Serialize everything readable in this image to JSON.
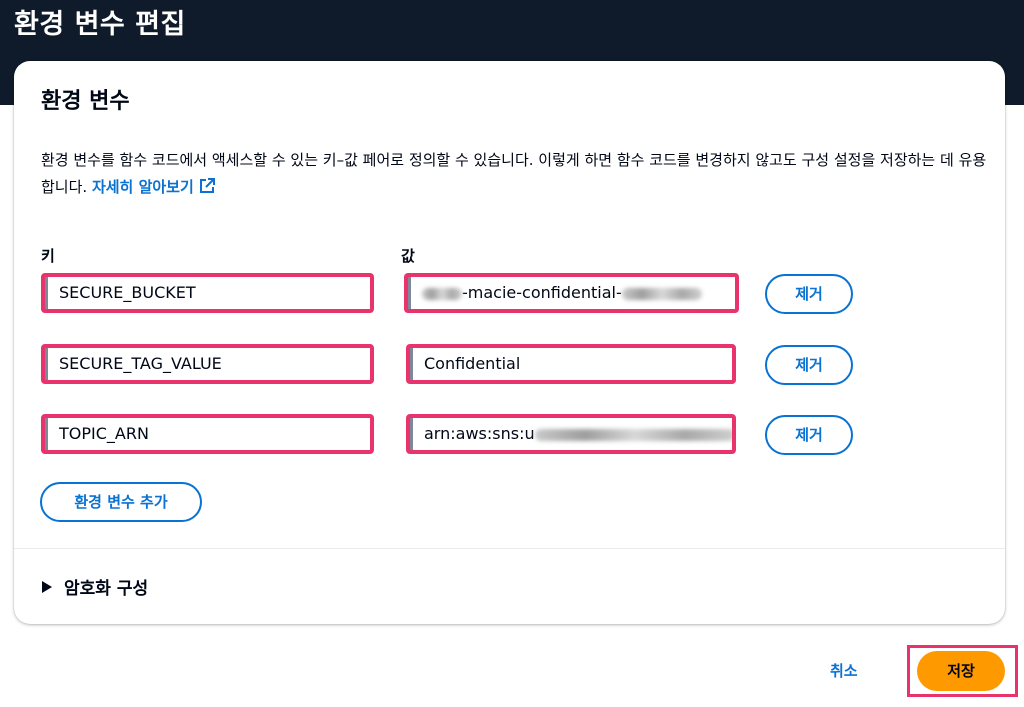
{
  "header": {
    "title": "환경 변수 편집"
  },
  "panel": {
    "title": "환경 변수",
    "description": "환경 변수를 함수 코드에서 액세스할 수 있는 키–값 페어로 정의할 수 있습니다. 이렇게 하면 함수 코드를 변경하지 않고도 구성 설정을 저장하는 데 유용합니다.",
    "learn_more_link": "자세히 알아보기",
    "learn_more_icon": "external-link-icon",
    "key_label": "키",
    "value_label": "값",
    "variables": [
      {
        "key": "SECURE_BUCKET",
        "value_prefix": "",
        "value_suffix": "-macie-confidential-",
        "remove_label": "제거"
      },
      {
        "key": "SECURE_TAG_VALUE",
        "value_prefix": "Confidential",
        "value_suffix": "",
        "remove_label": "제거"
      },
      {
        "key": "TOPIC_ARN",
        "value_prefix": "arn:aws:sns:u",
        "value_suffix": "",
        "remove_label": "제거"
      }
    ],
    "add_button": "환경 변수 추가",
    "encryption_section": "암호화 구성"
  },
  "footer": {
    "cancel_label": "취소",
    "save_label": "저장"
  },
  "colors": {
    "header_bg": "#0f1b2a",
    "link": "#0972d3",
    "primary_button": "#ff9900",
    "highlight": "#e8336d"
  }
}
